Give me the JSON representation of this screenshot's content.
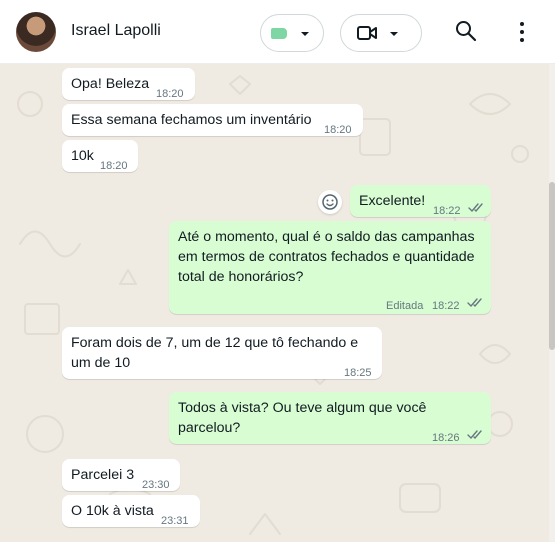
{
  "header": {
    "contact_name": "Israel Lapolli",
    "label_color": "#7ed6a5"
  },
  "messages": [
    {
      "dir": "in",
      "text": "Opa! Beleza",
      "time": "18:20"
    },
    {
      "dir": "in",
      "text": "Essa semana fechamos um inventário",
      "time": "18:20"
    },
    {
      "dir": "in",
      "text": "10k",
      "time": "18:20"
    },
    {
      "dir": "out",
      "text": "Excelente!",
      "time": "18:22",
      "status": "read"
    },
    {
      "dir": "out",
      "text": "Até o momento, qual é o saldo das campanhas em termos de contratos fechados e quantidade total de honorários?",
      "meta": "Editada",
      "time": "18:22",
      "status": "read"
    },
    {
      "dir": "in",
      "text": "Foram dois de 7, um de 12 que tô fechando e um de 10",
      "time": "18:25"
    },
    {
      "dir": "out",
      "text": "Todos à vista? Ou teve algum que você parcelou?",
      "time": "18:26",
      "status": "read"
    },
    {
      "dir": "in",
      "text": "Parcelei 3",
      "time": "23:30"
    },
    {
      "dir": "in",
      "text": "O 10k à vista",
      "time": "23:31"
    }
  ],
  "colors": {
    "incoming_bubble": "#ffffff",
    "outgoing_bubble": "#d9fdd3",
    "chat_background": "#efeae2",
    "read_ticks": "#667781"
  }
}
